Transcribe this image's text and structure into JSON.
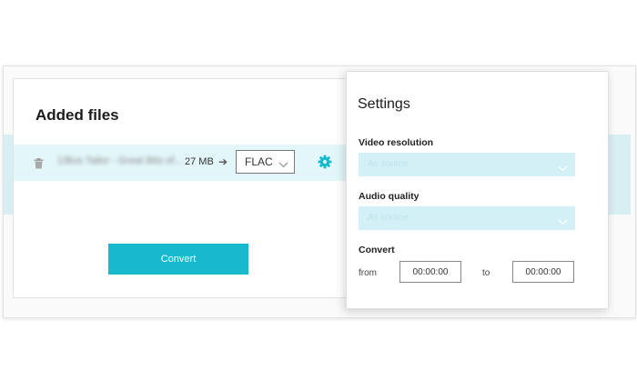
{
  "main": {
    "title": "Added files",
    "file": {
      "name": "1/Bus Tailor - Great Bits of...",
      "size": "27 MB",
      "format": "FLAC"
    },
    "convert_label": "Convert"
  },
  "settings": {
    "title": "Settings",
    "video_resolution": {
      "label": "Video resolution",
      "value": "As source"
    },
    "audio_quality": {
      "label": "Audio quality",
      "value": "As source"
    },
    "convert": {
      "label": "Convert",
      "from_label": "from",
      "from_value": "00:00:00",
      "to_label": "to",
      "to_value": "00:00:00"
    }
  },
  "colors": {
    "accent": "#18b9cd",
    "row_highlight": "#e3f6f9",
    "select_fill": "#d2f0f5"
  },
  "icons": [
    "trash-icon",
    "arrow-right-icon",
    "chevron-down-icon",
    "gear-icon"
  ]
}
